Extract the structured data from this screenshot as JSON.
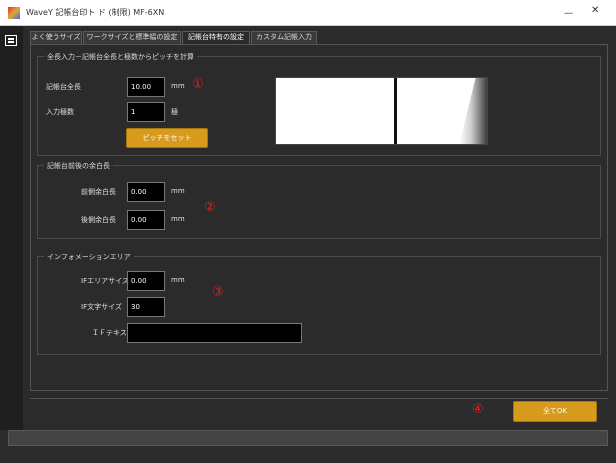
{
  "window": {
    "title": "WaveY 記帳台印ト ド (制限) MF-6XN",
    "min_glyph": "ᅳ",
    "close_glyph": "✕"
  },
  "tabs": [
    {
      "label": "よく使うサイズ",
      "active": false
    },
    {
      "label": "ワークサイズと標準幅の設定",
      "active": false
    },
    {
      "label": "記帳台特有の設定",
      "active": true
    },
    {
      "label": "カスタム記帳入力",
      "active": false
    }
  ],
  "section1": {
    "legend": "全長入力－記帳台全長と極数からピッチを計算",
    "length_label": "記帳台全長",
    "length_value": "10.00",
    "length_unit": "mm",
    "count_label": "入力極数",
    "count_value": "1",
    "count_unit": "極",
    "set_button": "ピッチをセット"
  },
  "section2": {
    "legend": "記帳台前後の余白長",
    "front_label": "前側余白長",
    "front_value": "0.00",
    "front_unit": "mm",
    "back_label": "後側余白長",
    "back_value": "0.00",
    "back_unit": "mm"
  },
  "section3": {
    "legend": "インフォメーションエリア",
    "area_label": "IFエリアサイズ",
    "area_value": "0.00",
    "area_unit": "mm",
    "font_label": "IF文字サイズ",
    "font_value": "30",
    "text_label": "ＩＦテキスト",
    "text_value": ""
  },
  "markers": [
    "①",
    "②",
    "③",
    "④"
  ],
  "footer": {
    "ok_button": "全てOK"
  },
  "colors": {
    "accent_gold": "#d69a1c",
    "marker_red": "#e02020",
    "background": "#2b2b2b"
  }
}
